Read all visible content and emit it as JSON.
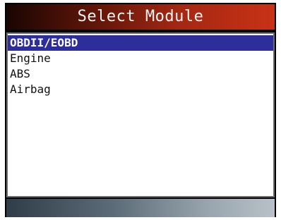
{
  "title": "Select Module",
  "menu": {
    "items": [
      {
        "label": "OBDII/EOBD",
        "selected": true
      },
      {
        "label": "Engine",
        "selected": false
      },
      {
        "label": "ABS",
        "selected": false
      },
      {
        "label": "Airbag",
        "selected": false
      }
    ]
  },
  "colors": {
    "title_bar": "#a52812",
    "selection": "#2d2d9c",
    "footer": "#5c6c78"
  }
}
